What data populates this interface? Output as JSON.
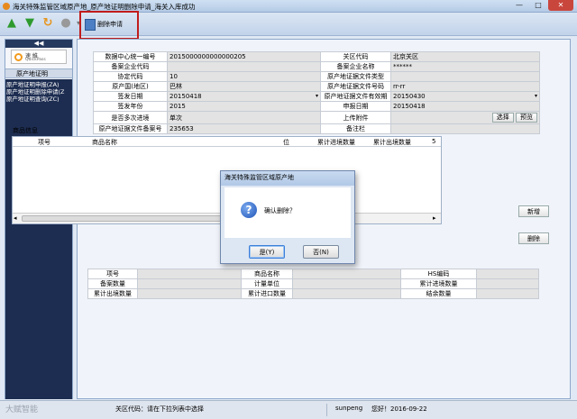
{
  "window": {
    "title": "海关特殊监管区域原产地_原产地证明删除申请_海关入库成功",
    "controls": [
      "—",
      "□",
      "✕"
    ]
  },
  "toolbar": {
    "delete_label": "删除申请"
  },
  "sidebar": {
    "collapse": "◀◀",
    "logo_text": "速 維",
    "logo_sub": "QuickPass",
    "section": "原产地证明",
    "items": [
      "原产地证明申报(ZA)",
      "原产地证明删除申请(Z",
      "原产地证明查询(ZC)"
    ]
  },
  "form": {
    "rows": [
      {
        "l1": "数据中心统一编号",
        "v1": "2015000000000000205",
        "l2": "关区代码",
        "v2": "北京关区"
      },
      {
        "l1": "备案企业代码",
        "v1": "",
        "l2": "备案企业名称",
        "v2": "******"
      },
      {
        "l1": "协定代码",
        "v1": "10",
        "l2": "原产地证据文件类型",
        "v2": ""
      },
      {
        "l1": "原产国(地区)",
        "v1": "巴林",
        "l2": "原产地证据文件号码",
        "v2": "rr-rr"
      },
      {
        "l1": "签发日期",
        "v1": "20150418",
        "l2": "原产地证据文件有效期",
        "v2": "20150430"
      },
      {
        "l1": "签发年份",
        "v1": "2015",
        "l2": "申报日期",
        "v2": "20150418"
      },
      {
        "l1": "是否多次进境",
        "v1": "单次",
        "l2": "上传附件",
        "v2": ""
      },
      {
        "l1": "原产地证据文件备案号",
        "v1": "235653",
        "l2": "备注栏",
        "v2": ""
      }
    ],
    "select_label": "选择",
    "preview_label": "预览"
  },
  "goods": {
    "title": "商品信息",
    "columns": [
      "项号",
      "商品名称",
      "位",
      "累计进境数量",
      "累计出境数量",
      "5"
    ],
    "new_label": "新增",
    "delete_label": "删除"
  },
  "detail": {
    "rows": [
      {
        "l1": "项号",
        "v1": "",
        "l2": "商品名称",
        "v2": "",
        "l3": "HS编码",
        "v3": ""
      },
      {
        "l1": "备案数量",
        "v1": "",
        "l2": "计量单位",
        "v2": "",
        "l3": "累计进境数量",
        "v3": ""
      },
      {
        "l1": "累计出境数量",
        "v1": "",
        "l2": "累计进口数量",
        "v2": "",
        "l3": "结余数量",
        "v3": ""
      }
    ]
  },
  "dialog": {
    "title": "海关特殊监管区域原产地",
    "message": "确认删除？",
    "yes_label": "是(Y)",
    "no_label": "否(N)"
  },
  "status": {
    "hint": "关区代码：请在下拉列表中选择",
    "user": "sunpeng",
    "greeting": "您好！2016-09-22",
    "watermark": "大赋智能"
  },
  "colors": {
    "highlight": "#c11c1c",
    "sidebar_nav": "#1d2d51"
  }
}
